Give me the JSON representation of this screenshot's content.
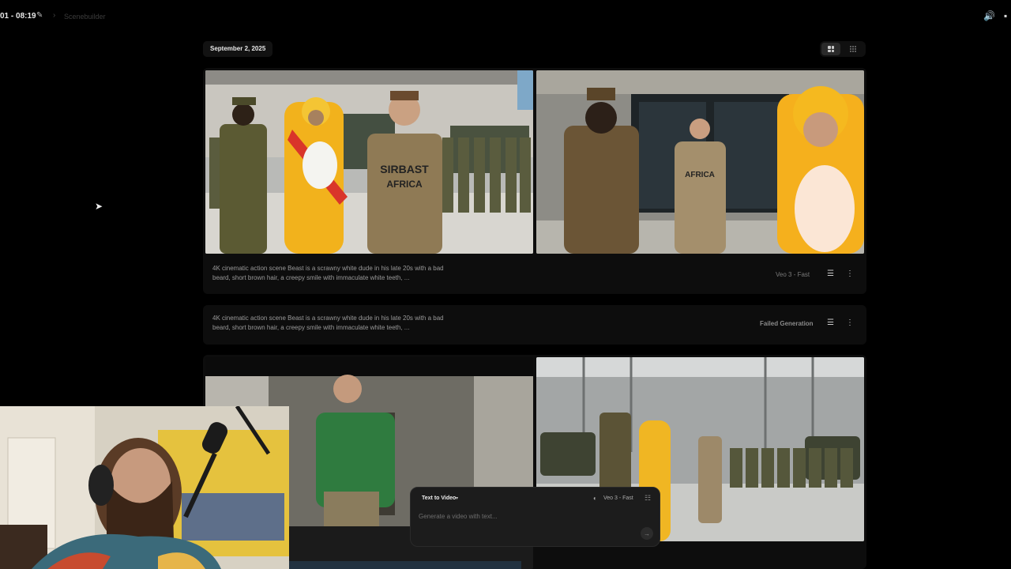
{
  "topbar": {
    "project_title": "01 - 08:19",
    "breadcrumb": "Scenebuilder"
  },
  "feed": {
    "date": "September 2, 2025",
    "generations": [
      {
        "prompt": "4K cinematic action scene Beast is a scrawny white dude in his late 20s with a bad beard, short brown hair, a creepy smile with immaculate white teeth, ...",
        "model": "Veo 3 - Fast",
        "shirt_text_1": "SIRBAST",
        "shirt_text_2": "AFRICA"
      },
      {
        "prompt": "4K cinematic action scene Beast is a scrawny white dude in his late 20s with a bad beard, short brown hair, a creepy smile with immaculate white teeth, ...",
        "status": "Failed Generation"
      }
    ]
  },
  "composer": {
    "mode": "Text to Video",
    "model": "Veo 3 - Fast",
    "placeholder": "Generate a video with text..."
  },
  "colors": {
    "background": "#000000",
    "card": "#0d0d0d",
    "composer": "#1c1c1c"
  }
}
